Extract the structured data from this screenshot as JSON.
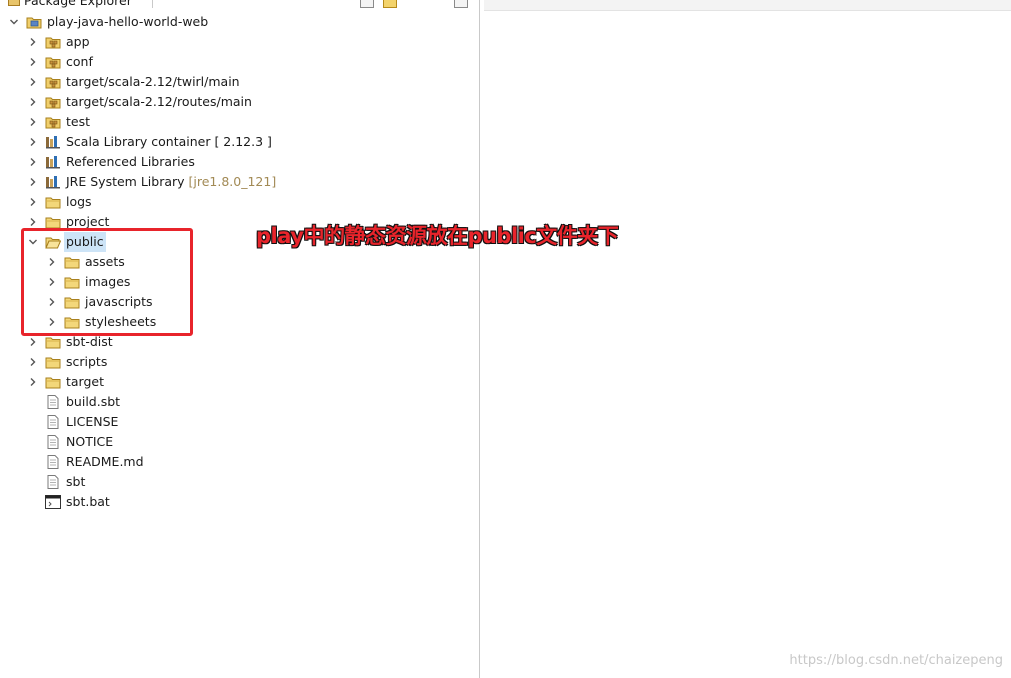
{
  "view": {
    "tab_title": "Package Explorer"
  },
  "tree": {
    "project": "play-java-hello-world-web",
    "items": [
      {
        "label": "app",
        "kind": "package-folder"
      },
      {
        "label": "conf",
        "kind": "package-folder"
      },
      {
        "label": "target/scala-2.12/twirl/main",
        "kind": "package-folder"
      },
      {
        "label": "target/scala-2.12/routes/main",
        "kind": "package-folder"
      },
      {
        "label": "test",
        "kind": "package-folder"
      },
      {
        "label": "Scala Library container [ 2.12.3 ]",
        "kind": "library"
      },
      {
        "label": "Referenced Libraries",
        "kind": "library"
      },
      {
        "label": "JRE System Library",
        "detail": "[jre1.8.0_121]",
        "kind": "library"
      },
      {
        "label": "logs",
        "kind": "folder"
      },
      {
        "label": "project",
        "kind": "folder"
      },
      {
        "label": "public",
        "kind": "folder-open"
      },
      {
        "label": "assets",
        "kind": "folder"
      },
      {
        "label": "images",
        "kind": "folder"
      },
      {
        "label": "javascripts",
        "kind": "folder"
      },
      {
        "label": "stylesheets",
        "kind": "folder"
      },
      {
        "label": "sbt-dist",
        "kind": "folder"
      },
      {
        "label": "scripts",
        "kind": "folder"
      },
      {
        "label": "target",
        "kind": "folder"
      },
      {
        "label": "build.sbt",
        "kind": "file"
      },
      {
        "label": "LICENSE",
        "kind": "file"
      },
      {
        "label": "NOTICE",
        "kind": "file"
      },
      {
        "label": "README.md",
        "kind": "file"
      },
      {
        "label": "sbt",
        "kind": "file"
      },
      {
        "label": "sbt.bat",
        "kind": "batch-file"
      }
    ]
  },
  "annotation": {
    "text": "play中的静态资源放在public文件夹下",
    "color": "#e8242b"
  },
  "watermark": "https://blog.csdn.net/chaizepeng"
}
